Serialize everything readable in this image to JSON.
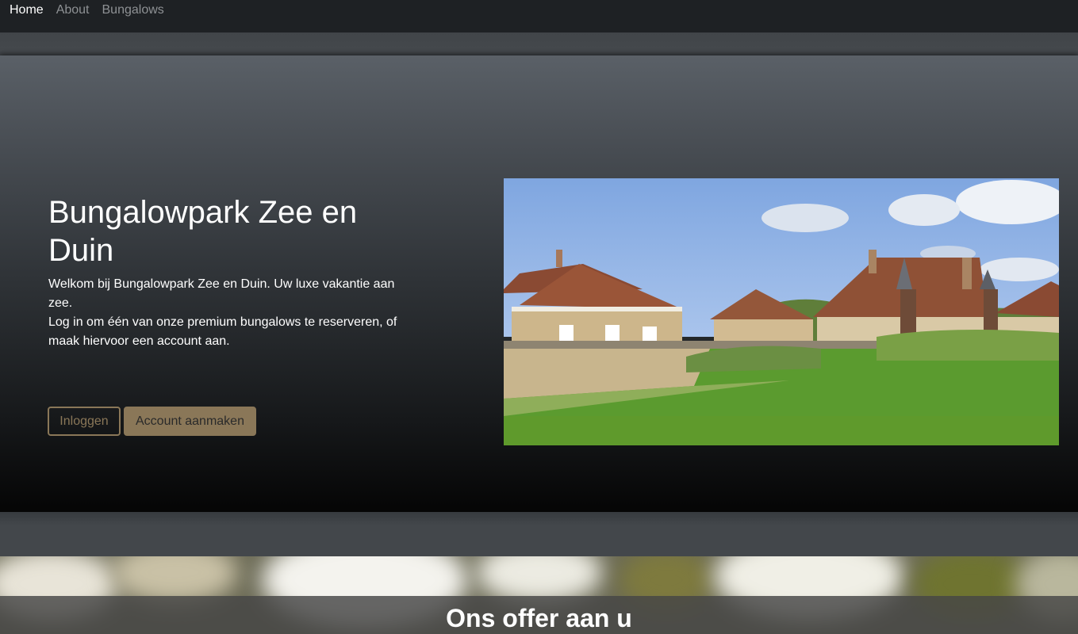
{
  "nav": {
    "items": [
      {
        "label": "Home",
        "active": true
      },
      {
        "label": "About",
        "active": false
      },
      {
        "label": "Bungalows",
        "active": false
      }
    ]
  },
  "hero": {
    "title": "Bungalowpark Zee en Duin",
    "text_line1": "Welkom bij Bungalowpark Zee en Duin. Uw luxe vakantie aan zee.",
    "text_line2": "Log in om één van onze premium bungalows te reserveren, of maak hiervoor een account aan.",
    "login_button": "Inloggen",
    "register_button": "Account aanmaken"
  },
  "offer": {
    "title": "Ons offer aan u"
  },
  "colors": {
    "accent": "#8a7758",
    "navbar": "#1e2124",
    "page": "#43474b"
  }
}
